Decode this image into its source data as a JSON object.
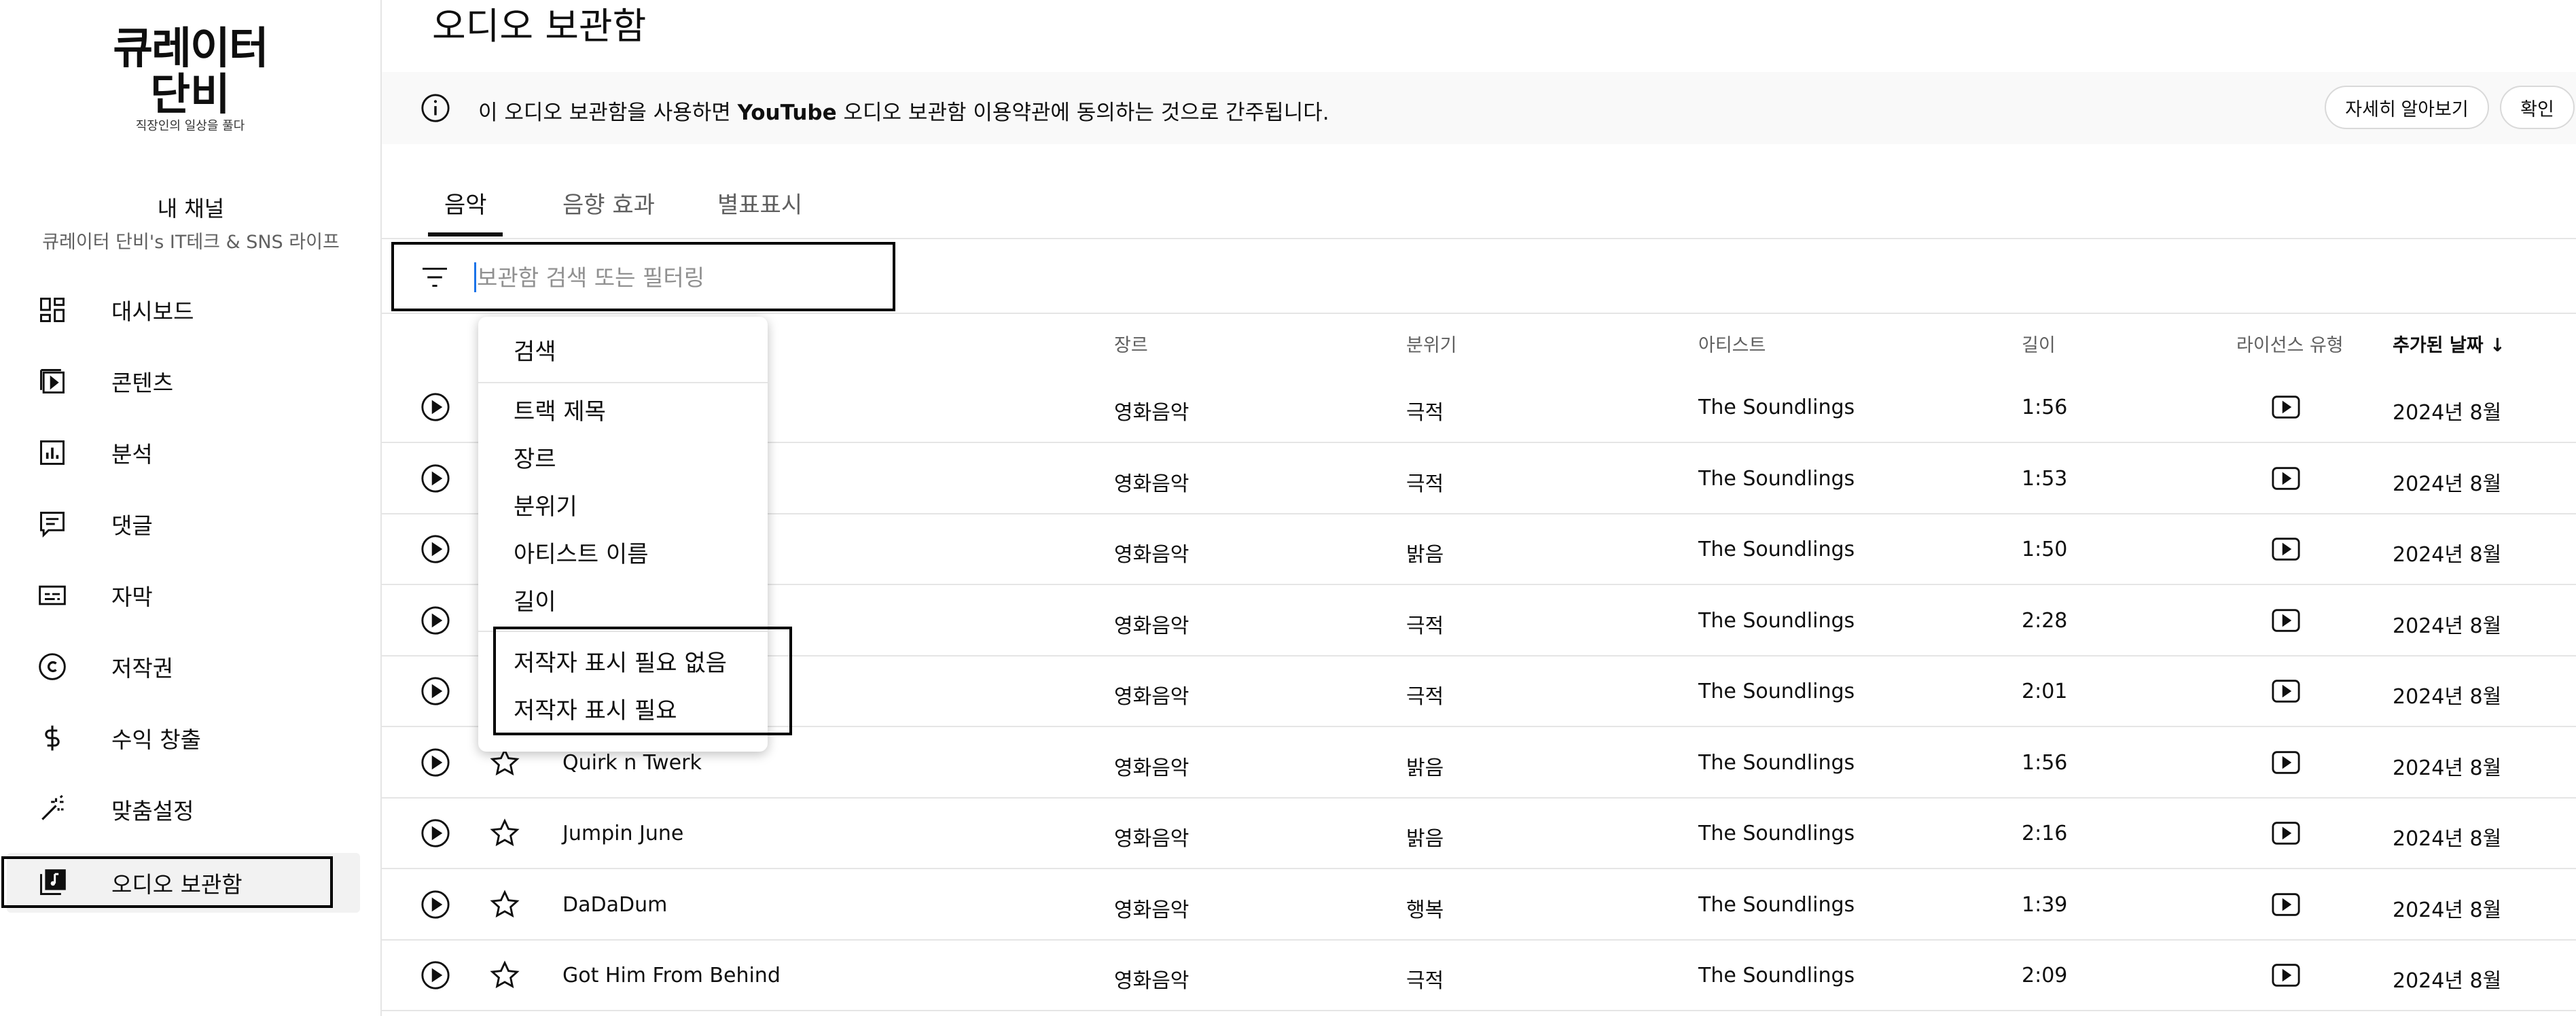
{
  "sidebar": {
    "logo": {
      "line1": "큐레이터",
      "line2": "단비",
      "line3": "직장인의 일상을 풀다"
    },
    "channel_title": "내 채널",
    "channel_name": "큐레이터 단비's IT테크 & SNS 라이프",
    "items": [
      {
        "label": "대시보드",
        "icon": "dashboard-icon"
      },
      {
        "label": "콘텐츠",
        "icon": "content-icon"
      },
      {
        "label": "분석",
        "icon": "analytics-icon"
      },
      {
        "label": "댓글",
        "icon": "comments-icon"
      },
      {
        "label": "자막",
        "icon": "subtitles-icon"
      },
      {
        "label": "저작권",
        "icon": "copyright-icon"
      },
      {
        "label": "수익 창출",
        "icon": "dollar-icon"
      },
      {
        "label": "맞춤설정",
        "icon": "magic-wand-icon"
      },
      {
        "label": "오디오 보관함",
        "icon": "audio-library-icon",
        "active": true
      }
    ]
  },
  "page": {
    "title": "오디오 보관함"
  },
  "banner": {
    "text_before": "이 오디오 보관함을 사용하면 ",
    "text_bold": "YouTube",
    "text_after": " 오디오 보관함 이용약관에 동의하는 것으로 간주됩니다.",
    "learn_more": "자세히 알아보기",
    "confirm": "확인"
  },
  "tabs": [
    {
      "label": "음악",
      "active": true
    },
    {
      "label": "음향 효과"
    },
    {
      "label": "별표표시"
    }
  ],
  "filter": {
    "placeholder": "보관함 검색 또는 필터링"
  },
  "table": {
    "headers": {
      "genre": "장르",
      "mood": "분위기",
      "artist": "아티스트",
      "duration": "길이",
      "license": "라이선스 유형",
      "added": "추가된 날짜",
      "sort_arrow": "↓"
    },
    "rows": [
      {
        "title": "",
        "genre": "영화음악",
        "mood": "극적",
        "artist": "The Soundlings",
        "duration": "1:56",
        "added": "2024년 8월"
      },
      {
        "title": "",
        "genre": "영화음악",
        "mood": "극적",
        "artist": "The Soundlings",
        "duration": "1:53",
        "added": "2024년 8월"
      },
      {
        "title": "",
        "genre": "영화음악",
        "mood": "밝음",
        "artist": "The Soundlings",
        "duration": "1:50",
        "added": "2024년 8월"
      },
      {
        "title": "",
        "genre": "영화음악",
        "mood": "극적",
        "artist": "The Soundlings",
        "duration": "2:28",
        "added": "2024년 8월"
      },
      {
        "title": "",
        "genre": "영화음악",
        "mood": "극적",
        "artist": "The Soundlings",
        "duration": "2:01",
        "added": "2024년 8월"
      },
      {
        "title": "Quirk n Twerk",
        "genre": "영화음악",
        "mood": "밝음",
        "artist": "The Soundlings",
        "duration": "1:56",
        "added": "2024년 8월"
      },
      {
        "title": "Jumpin June",
        "genre": "영화음악",
        "mood": "밝음",
        "artist": "The Soundlings",
        "duration": "2:16",
        "added": "2024년 8월"
      },
      {
        "title": "DaDaDum",
        "genre": "영화음악",
        "mood": "행복",
        "artist": "The Soundlings",
        "duration": "1:39",
        "added": "2024년 8월"
      },
      {
        "title": "Got Him From Behind",
        "genre": "영화음악",
        "mood": "극적",
        "artist": "The Soundlings",
        "duration": "2:09",
        "added": "2024년 8월"
      }
    ]
  },
  "dropdown": {
    "search": "검색",
    "options": [
      "트랙 제목",
      "장르",
      "분위기",
      "아티스트 이름",
      "길이"
    ],
    "attribution_options": [
      "저작자 표시 필요 없음",
      "저작자 표시 필요"
    ]
  }
}
